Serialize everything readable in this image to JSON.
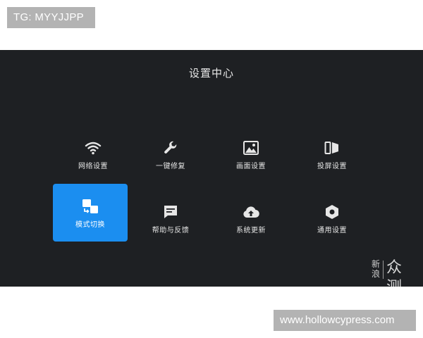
{
  "watermark_top": "TG: MYYJJPP",
  "watermark_bottom": "www.hollowcypress.com",
  "screen": {
    "title": "设置中心",
    "items": [
      {
        "label": "网络设置",
        "icon": "wifi-icon"
      },
      {
        "label": "一键修复",
        "icon": "wrench-icon"
      },
      {
        "label": "画面设置",
        "icon": "picture-icon"
      },
      {
        "label": "投屏设置",
        "icon": "cast-icon"
      },
      {
        "label": "模式切换",
        "icon": "mode-switch-icon",
        "selected": true
      },
      {
        "label": "帮助与反馈",
        "icon": "feedback-icon"
      },
      {
        "label": "系统更新",
        "icon": "cloud-upload-icon"
      },
      {
        "label": "通用设置",
        "icon": "hexagon-settings-icon"
      }
    ]
  },
  "logo": {
    "small": "新浪",
    "big": "众测"
  },
  "colors": {
    "background": "#1e2023",
    "selected": "#1b8ef0"
  }
}
